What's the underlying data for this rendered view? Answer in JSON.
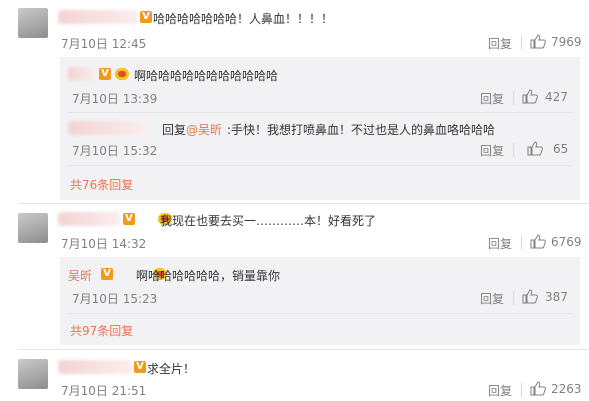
{
  "comments": [
    {
      "text": "哈哈哈哈哈哈哈！人鼻血！！！！",
      "time": "7月10日 12:45",
      "reply_label": "回复",
      "likes": "7969",
      "replies": [
        {
          "text": "啊哈哈哈哈哈哈哈哈哈哈哈",
          "time": "7月10日 13:39",
          "reply_label": "回复",
          "likes": "427"
        },
        {
          "prefix": "回复",
          "mention": "@吴昕",
          "text": ":手快！我想打喷鼻血！不过也是人的鼻血咯哈哈哈",
          "time": "7月10日 15:32",
          "reply_label": "回复",
          "likes": "65"
        }
      ],
      "more": "共76条回复"
    },
    {
      "text": "我现在也要去买一…………本！好看死了",
      "time": "7月10日 14:32",
      "reply_label": "回复",
      "likes": "6769",
      "replies": [
        {
          "name": "吴昕",
          "text": "啊哈哈哈哈哈哈，销量靠你",
          "time": "7月10日 15:23",
          "reply_label": "回复",
          "likes": "387"
        }
      ],
      "more": "共97条回复"
    },
    {
      "text": "求全片！",
      "time": "7月10日 21:51",
      "reply_label": "回复",
      "likes": "2263"
    }
  ],
  "badge_v": "V",
  "icons": {
    "like": "thumbs-up-icon",
    "verified": "verified-v-icon",
    "level": "member-level-icon"
  }
}
